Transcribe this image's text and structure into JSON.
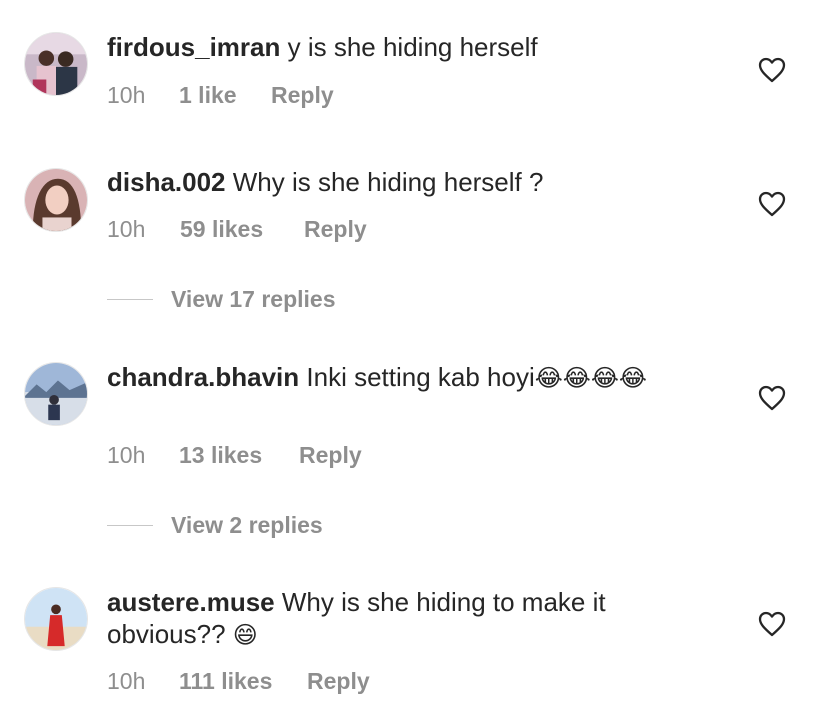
{
  "comments": [
    {
      "username": "firdous_imran",
      "text": "y is she hiding herself",
      "emoji": "",
      "time": "10h",
      "likes": "1 like",
      "reply": "Reply"
    },
    {
      "username": "disha.002",
      "text": "Why is she hiding herself ?",
      "emoji": "",
      "time": "10h",
      "likes": "59 likes",
      "reply": "Reply",
      "view_replies": "View 17 replies"
    },
    {
      "username": "chandra.bhavin",
      "text": "Inki setting kab hoyi",
      "emoji": "😂😂😂😂",
      "time": "10h",
      "likes": "13 likes",
      "reply": "Reply",
      "view_replies": "View 2 replies"
    },
    {
      "username": "austere.muse",
      "text": "Why is she hiding to make it obvious??",
      "emoji": "😄",
      "time": "10h",
      "likes": "111 likes",
      "reply": "Reply"
    }
  ],
  "icons": {
    "like": "heart-outline-icon"
  },
  "colors": {
    "text": "#262626",
    "meta": "#8e8e8e"
  }
}
